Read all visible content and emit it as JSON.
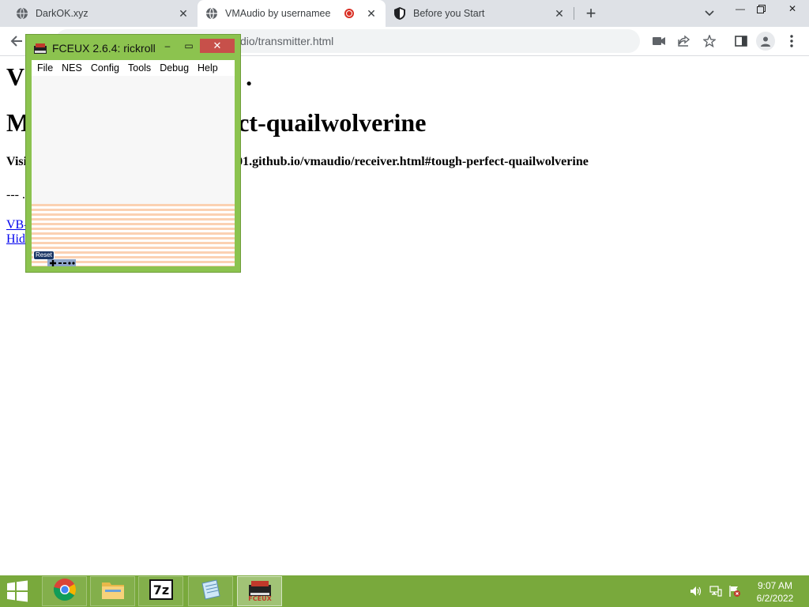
{
  "browser": {
    "tabs": [
      {
        "title": "DarkOK.xyz",
        "icon": "globe-icon",
        "active": false
      },
      {
        "title": "VMAudio by usernamee",
        "icon": "globe-icon",
        "active": true,
        "recording": true
      },
      {
        "title": "Before you Start",
        "icon": "shield-icon",
        "active": false
      }
    ],
    "new_tab_label": "+",
    "address_visible": "dio/transmitter.html"
  },
  "page": {
    "title_visible": "V",
    "title_tail_visible": ".",
    "machine_heading_start": "M",
    "machine_heading_end": "ct-quailwolverine",
    "visit_start": "Visi",
    "visit_end": "01.github.io/vmaudio/receiver.html#tough-perfect-quailwolverine",
    "dashes": "--- .",
    "links": [
      "VB-",
      "Hid"
    ]
  },
  "fceux": {
    "title": "FCEUX 2.6.4: rickroll",
    "menu": [
      "File",
      "NES",
      "Config",
      "Tools",
      "Debug",
      "Help"
    ],
    "badge": "Reset",
    "minimize": "–",
    "maximize": "▭",
    "close": "✕"
  },
  "taskbar": {
    "pinned": [
      "chrome-icon",
      "file-explorer-icon",
      "7zip-icon",
      "notepad-icon",
      "fceux-icon"
    ],
    "clock_time": "9:07 AM",
    "clock_date": "6/2/2022"
  },
  "colors": {
    "taskbar": "#79a93c",
    "fceux_frame": "#8cc34f",
    "fceux_close": "#c7504a",
    "link": "#0000ee"
  }
}
